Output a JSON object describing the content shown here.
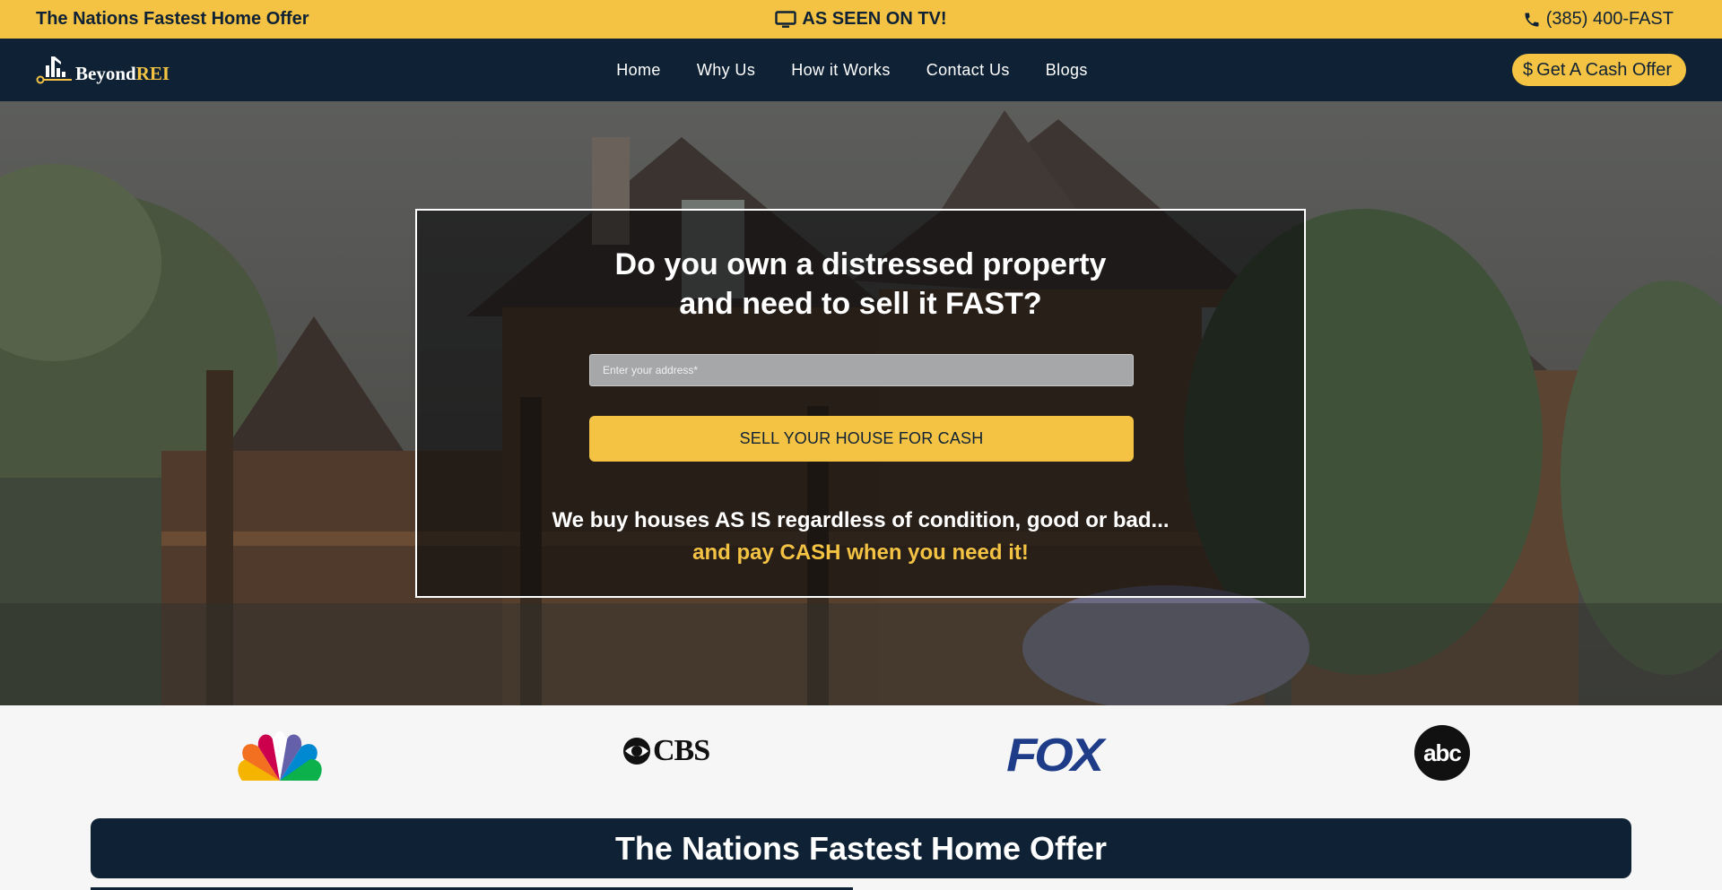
{
  "topbar": {
    "tagline": "The Nations Fastest Home Offer",
    "as_seen": "AS SEEN ON TV!",
    "tv_icon": "tv-icon",
    "phone_icon": "phone-icon",
    "phone": "(385) 400-FAST"
  },
  "nav": {
    "logo_main": "Beyond",
    "logo_accent": "REI",
    "items": [
      {
        "label": "Home"
      },
      {
        "label": "Why Us"
      },
      {
        "label": "How it Works"
      },
      {
        "label": "Contact Us"
      },
      {
        "label": "Blogs"
      }
    ],
    "cta_icon": "$",
    "cta_label": "Get A Cash Offer"
  },
  "hero": {
    "title_line1": "Do you own a distressed property",
    "title_line2": "and need to sell it FAST?",
    "address_placeholder": "Enter your address*",
    "sell_button": "SELL YOUR HOUSE FOR CASH",
    "sub_line1": "We buy houses AS IS regardless of condition, good or bad...",
    "sub_line2": "and pay CASH when you need it!"
  },
  "media_logos": [
    {
      "name": "nbc-logo"
    },
    {
      "name": "cbs-logo",
      "text": "CBS"
    },
    {
      "name": "fox-logo",
      "text": "FOX"
    },
    {
      "name": "abc-logo",
      "text": "abc"
    }
  ],
  "banner": {
    "title": "The Nations Fastest Home Offer"
  },
  "colors": {
    "accent": "#f4c344",
    "navy": "#0f2235"
  }
}
